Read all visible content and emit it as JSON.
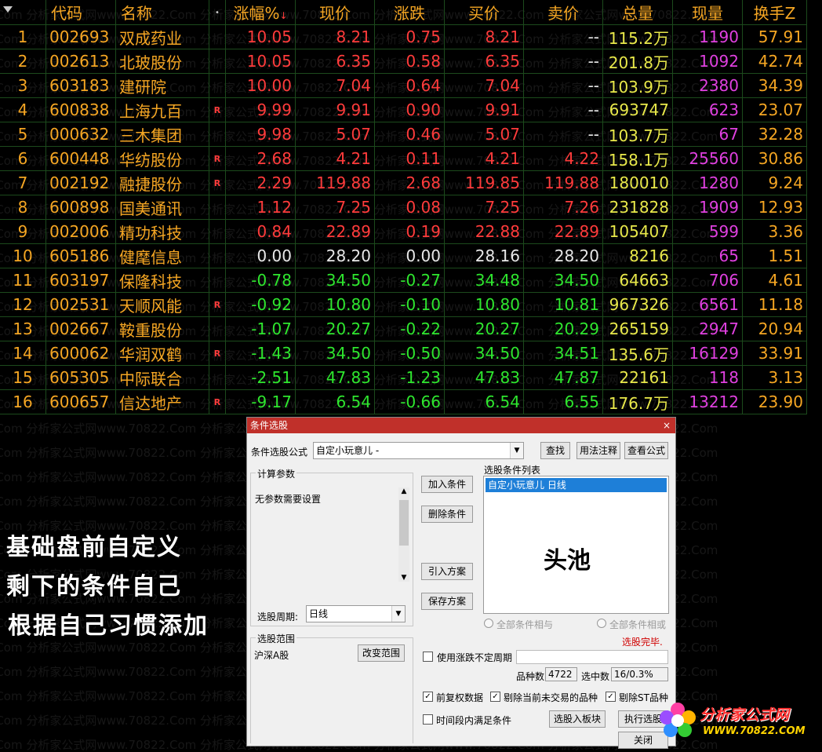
{
  "headers": [
    "代码",
    "名称",
    "涨幅%",
    "现价",
    "涨跌",
    "买价",
    "卖价",
    "总量",
    "现量",
    "换手Z"
  ],
  "sort_indicator": "↓",
  "rows": [
    {
      "no": "1",
      "code": "002693",
      "name": "双成药业",
      "r": "",
      "chg_pct": "10.05",
      "price": "8.21",
      "chg": "0.75",
      "bid": "8.21",
      "ask": "--",
      "vol": "115.2万",
      "cur": "1190",
      "turn": "57.91",
      "dir": "up"
    },
    {
      "no": "2",
      "code": "002613",
      "name": "北玻股份",
      "r": "",
      "chg_pct": "10.05",
      "price": "6.35",
      "chg": "0.58",
      "bid": "6.35",
      "ask": "--",
      "vol": "201.8万",
      "cur": "1092",
      "turn": "42.74",
      "dir": "up"
    },
    {
      "no": "3",
      "code": "603183",
      "name": "建研院",
      "r": "",
      "chg_pct": "10.00",
      "price": "7.04",
      "chg": "0.64",
      "bid": "7.04",
      "ask": "--",
      "vol": "103.9万",
      "cur": "2380",
      "turn": "34.39",
      "dir": "up"
    },
    {
      "no": "4",
      "code": "600838",
      "name": "上海九百",
      "r": "R",
      "chg_pct": "9.99",
      "price": "9.91",
      "chg": "0.90",
      "bid": "9.91",
      "ask": "--",
      "vol": "693747",
      "cur": "623",
      "turn": "23.07",
      "dir": "up"
    },
    {
      "no": "5",
      "code": "000632",
      "name": "三木集团",
      "r": "",
      "chg_pct": "9.98",
      "price": "5.07",
      "chg": "0.46",
      "bid": "5.07",
      "ask": "--",
      "vol": "103.7万",
      "cur": "67",
      "turn": "32.28",
      "dir": "up"
    },
    {
      "no": "6",
      "code": "600448",
      "name": "华纺股份",
      "r": "R",
      "chg_pct": "2.68",
      "price": "4.21",
      "chg": "0.11",
      "bid": "4.21",
      "ask": "4.22",
      "vol": "158.1万",
      "cur": "25560",
      "turn": "30.86",
      "dir": "up"
    },
    {
      "no": "7",
      "code": "002192",
      "name": "融捷股份",
      "r": "R",
      "chg_pct": "2.29",
      "price": "119.88",
      "chg": "2.68",
      "bid": "119.85",
      "ask": "119.88",
      "vol": "180010",
      "cur": "1280",
      "turn": "9.24",
      "dir": "up"
    },
    {
      "no": "8",
      "code": "600898",
      "name": "国美通讯",
      "r": "",
      "chg_pct": "1.12",
      "price": "7.25",
      "chg": "0.08",
      "bid": "7.25",
      "ask": "7.26",
      "vol": "231828",
      "cur": "1909",
      "turn": "12.93",
      "dir": "up"
    },
    {
      "no": "9",
      "code": "002006",
      "name": "精功科技",
      "r": "",
      "chg_pct": "0.84",
      "price": "22.89",
      "chg": "0.19",
      "bid": "22.88",
      "ask": "22.89",
      "vol": "105407",
      "cur": "599",
      "turn": "3.36",
      "dir": "up"
    },
    {
      "no": "10",
      "code": "605186",
      "name": "健麾信息",
      "r": "",
      "chg_pct": "0.00",
      "price": "28.20",
      "chg": "0.00",
      "bid": "28.16",
      "ask": "28.20",
      "vol": "8216",
      "cur": "65",
      "turn": "1.51",
      "dir": "flat"
    },
    {
      "no": "11",
      "code": "603197",
      "name": "保隆科技",
      "r": "",
      "chg_pct": "-0.78",
      "price": "34.50",
      "chg": "-0.27",
      "bid": "34.48",
      "ask": "34.50",
      "vol": "64663",
      "cur": "706",
      "turn": "4.61",
      "dir": "down"
    },
    {
      "no": "12",
      "code": "002531",
      "name": "天顺风能",
      "r": "R",
      "chg_pct": "-0.92",
      "price": "10.80",
      "chg": "-0.10",
      "bid": "10.80",
      "ask": "10.81",
      "vol": "967326",
      "cur": "6561",
      "turn": "11.18",
      "dir": "down"
    },
    {
      "no": "13",
      "code": "002667",
      "name": "鞍重股份",
      "r": "",
      "chg_pct": "-1.07",
      "price": "20.27",
      "chg": "-0.22",
      "bid": "20.27",
      "ask": "20.29",
      "vol": "265159",
      "cur": "2947",
      "turn": "20.94",
      "dir": "down"
    },
    {
      "no": "14",
      "code": "600062",
      "name": "华润双鹤",
      "r": "R",
      "chg_pct": "-1.43",
      "price": "34.50",
      "chg": "-0.50",
      "bid": "34.50",
      "ask": "34.51",
      "vol": "135.6万",
      "cur": "16129",
      "turn": "33.91",
      "dir": "down"
    },
    {
      "no": "15",
      "code": "605305",
      "name": "中际联合",
      "r": "",
      "chg_pct": "-2.51",
      "price": "47.83",
      "chg": "-1.23",
      "bid": "47.83",
      "ask": "47.87",
      "vol": "22161",
      "cur": "118",
      "turn": "3.13",
      "dir": "down"
    },
    {
      "no": "16",
      "code": "600657",
      "name": "信达地产",
      "r": "R",
      "chg_pct": "-9.17",
      "price": "6.54",
      "chg": "-0.66",
      "bid": "6.54",
      "ask": "6.55",
      "vol": "176.7万",
      "cur": "13212",
      "turn": "23.90",
      "dir": "down"
    }
  ],
  "overlay_lines": [
    "基础盘前自定义",
    "剩下的条件自己",
    "根据自己习惯添加"
  ],
  "watermark_text": "2.Com 分析家公式网www.70822.Com 分析家公式网www.70822.Com 分析家公式网www.70822.Com 分析家公式网www.70822.Com",
  "dialog": {
    "title": "条件选股",
    "close": "×",
    "formula_label": "条件选股公式",
    "formula_value": "自定小玩意儿 -",
    "find_btn": "查找",
    "usage_btn": "用法注释",
    "view_btn": "查看公式",
    "calc_params_title": "计算参数",
    "no_params": "无参数需要设置",
    "add_btn": "加入条件",
    "del_btn": "删除条件",
    "import_btn": "引入方案",
    "save_btn": "保存方案",
    "cond_list_title": "选股条件列表",
    "cond_item": "自定小玩意儿  日线",
    "pool_text": "头池",
    "period_label": "选股周期:",
    "period_value": "日线",
    "radio_and": "全部条件相与",
    "radio_or": "全部条件相或",
    "done_text": "选股完毕.",
    "range_title": "选股范围",
    "range_value": "沪深A股",
    "change_range_btn": "改变范围",
    "use_period_label": "使用涨跌不定周期",
    "count_label": "品种数",
    "count_value": "4722",
    "selected_label": "选中数",
    "selected_value": "16/0.3%",
    "opt_adjust": "前复权数据",
    "opt_exclude_untraded": "剔除当前未交易的品种",
    "opt_exclude_st": "剔除ST品种",
    "opt_time": "时间段内满足条件",
    "to_block_btn": "选股入板块",
    "exec_btn": "执行选股",
    "close_btn": "关闭"
  },
  "logo": {
    "name": "分析家公式网",
    "url": "WWW.70822.COM"
  },
  "colors": {
    "up": "#ff3b3b",
    "down": "#2ee62e",
    "flat": "#e8e8e8",
    "header": "#f5a623",
    "grid": "#1c4a1c",
    "volume": "#e8e84a",
    "current": "#e040e0",
    "title_bar": "#c0302a"
  }
}
